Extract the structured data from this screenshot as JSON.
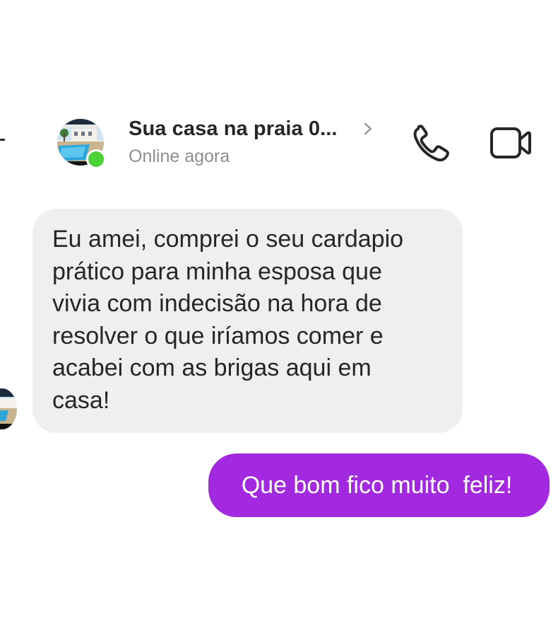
{
  "header": {
    "contact_name": "Sua casa na praia 0...",
    "status": "Online agora",
    "icons": {
      "back": "back-arrow-icon",
      "chevron": "chevron-right-icon",
      "call": "phone-icon",
      "video": "video-camera-icon"
    }
  },
  "messages": [
    {
      "direction": "incoming",
      "text": "Eu amei, comprei o seu cardapio\nprático para minha esposa que\nvivia com indecisão na hora de\nresolver o que iríamos comer e\nacabei com as brigas aqui em\ncasa!"
    },
    {
      "direction": "outgoing",
      "text": "Que bom fico muito  feliz!"
    }
  ],
  "colors": {
    "incoming_bubble": "#efefef",
    "outgoing_bubble": "#a229e0",
    "online": "#4cd137",
    "secondary_text": "#8e8e8e"
  }
}
